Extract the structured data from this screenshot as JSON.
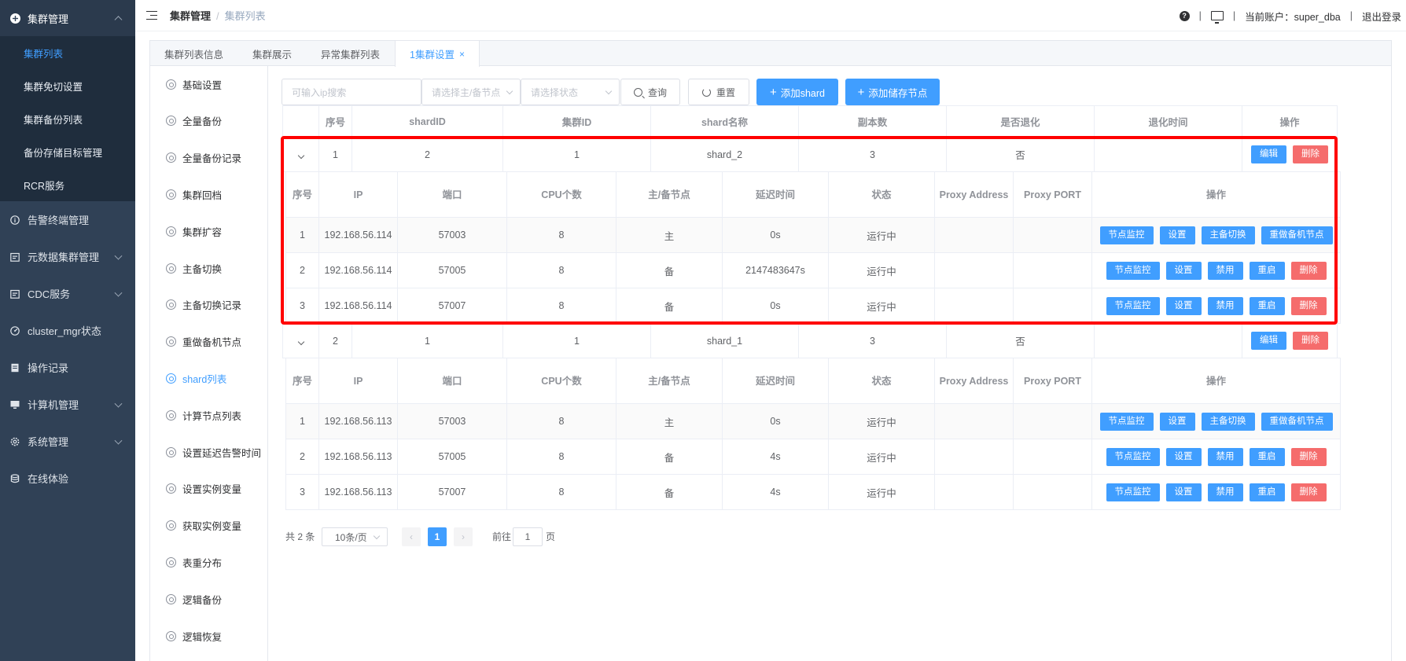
{
  "sidebar": {
    "group": {
      "label": "集群管理",
      "icon": "plus-circle-icon"
    },
    "sub_items": [
      {
        "label": "集群列表",
        "active": true
      },
      {
        "label": "集群免切设置"
      },
      {
        "label": "集群备份列表"
      },
      {
        "label": "备份存储目标管理"
      },
      {
        "label": "RCR服务"
      }
    ],
    "items": [
      {
        "label": "告警终端管理",
        "icon": "info-circle-icon",
        "chevron": false
      },
      {
        "label": "元数据集群管理",
        "icon": "calendar-icon",
        "chevron": true
      },
      {
        "label": "CDC服务",
        "icon": "calendar-icon",
        "chevron": true
      },
      {
        "label": "cluster_mgr状态",
        "icon": "dashboard-icon",
        "chevron": false
      },
      {
        "label": "操作记录",
        "icon": "document-icon",
        "chevron": false
      },
      {
        "label": "计算机管理",
        "icon": "monitor-icon",
        "chevron": true
      },
      {
        "label": "系统管理",
        "icon": "gear-icon",
        "chevron": true
      },
      {
        "label": "在线体验",
        "icon": "database-icon",
        "chevron": false
      }
    ]
  },
  "header": {
    "breadcrumb": [
      "集群管理",
      "集群列表"
    ],
    "account_label": "当前账户：super_dba",
    "logout": "退出登录",
    "sep": "|"
  },
  "tabs": [
    {
      "label": "集群列表信息"
    },
    {
      "label": "集群展示"
    },
    {
      "label": "异常集群列表"
    },
    {
      "label": "1集群设置",
      "active": true,
      "close": "×"
    }
  ],
  "subnav": [
    {
      "label": "基础设置"
    },
    {
      "label": "全量备份"
    },
    {
      "label": "全量备份记录"
    },
    {
      "label": "集群回档"
    },
    {
      "label": "集群扩容"
    },
    {
      "label": "主备切换"
    },
    {
      "label": "主备切换记录"
    },
    {
      "label": "重做备机节点"
    },
    {
      "label": "shard列表",
      "active": true
    },
    {
      "label": "计算节点列表"
    },
    {
      "label": "设置延迟告警时间"
    },
    {
      "label": "设置实例变量"
    },
    {
      "label": "获取实例变量"
    },
    {
      "label": "表重分布"
    },
    {
      "label": "逻辑备份"
    },
    {
      "label": "逻辑恢复"
    }
  ],
  "toolbar": {
    "ip_placeholder": "可输入ip搜索",
    "node_placeholder": "请选择主/备节点",
    "status_placeholder": "请选择状态",
    "query": "查询",
    "reset": "重置",
    "add_shard": "添加shard",
    "add_storage": "添加储存节点",
    "plus": "+"
  },
  "outer_headers": [
    "序号",
    "shardID",
    "集群ID",
    "shard名称",
    "副本数",
    "是否退化",
    "退化时间",
    "操作"
  ],
  "inner_headers": [
    "序号",
    "IP",
    "端口",
    "CPU个数",
    "主/备节点",
    "延迟时间",
    "状态",
    "Proxy Address",
    "Proxy PORT",
    "操作"
  ],
  "btn": {
    "edit": "编辑",
    "delete": "删除",
    "monitor": "节点监控",
    "settings": "设置",
    "switch": "主备切换",
    "rebuild": "重做备机节点",
    "disable": "禁用",
    "restart": "重启"
  },
  "shards": [
    {
      "no": "1",
      "shard_id": "2",
      "cluster_id": "1",
      "name": "shard_2",
      "replicas": "3",
      "degraded": "否",
      "degraded_time": "",
      "nodes": [
        {
          "no": "1",
          "ip": "192.168.56.114",
          "port": "57003",
          "cpu": "8",
          "role": "主",
          "delay": "0s",
          "status": "运行中",
          "proxy_addr": "",
          "proxy_port": ""
        },
        {
          "no": "2",
          "ip": "192.168.56.114",
          "port": "57005",
          "cpu": "8",
          "role": "备",
          "delay": "2147483647s",
          "status": "运行中",
          "proxy_addr": "",
          "proxy_port": ""
        },
        {
          "no": "3",
          "ip": "192.168.56.114",
          "port": "57007",
          "cpu": "8",
          "role": "备",
          "delay": "0s",
          "status": "运行中",
          "proxy_addr": "",
          "proxy_port": ""
        }
      ]
    },
    {
      "no": "2",
      "shard_id": "1",
      "cluster_id": "1",
      "name": "shard_1",
      "replicas": "3",
      "degraded": "否",
      "degraded_time": "",
      "nodes": [
        {
          "no": "1",
          "ip": "192.168.56.113",
          "port": "57003",
          "cpu": "8",
          "role": "主",
          "delay": "0s",
          "status": "运行中",
          "proxy_addr": "",
          "proxy_port": ""
        },
        {
          "no": "2",
          "ip": "192.168.56.113",
          "port": "57005",
          "cpu": "8",
          "role": "备",
          "delay": "4s",
          "status": "运行中",
          "proxy_addr": "",
          "proxy_port": ""
        },
        {
          "no": "3",
          "ip": "192.168.56.113",
          "port": "57007",
          "cpu": "8",
          "role": "备",
          "delay": "4s",
          "status": "运行中",
          "proxy_addr": "",
          "proxy_port": ""
        }
      ]
    }
  ],
  "pagination": {
    "total": "共 2 条",
    "page_size": "10条/页",
    "current": "1",
    "goto_prefix": "前往",
    "goto_value": "1",
    "goto_suffix": "页",
    "prev": "‹",
    "next": "›"
  },
  "colors": {
    "primary": "#409eff",
    "danger": "#f56c6c",
    "success": "#67c23a",
    "sidebar_bg": "#304156",
    "highlight": "#ff0000"
  }
}
